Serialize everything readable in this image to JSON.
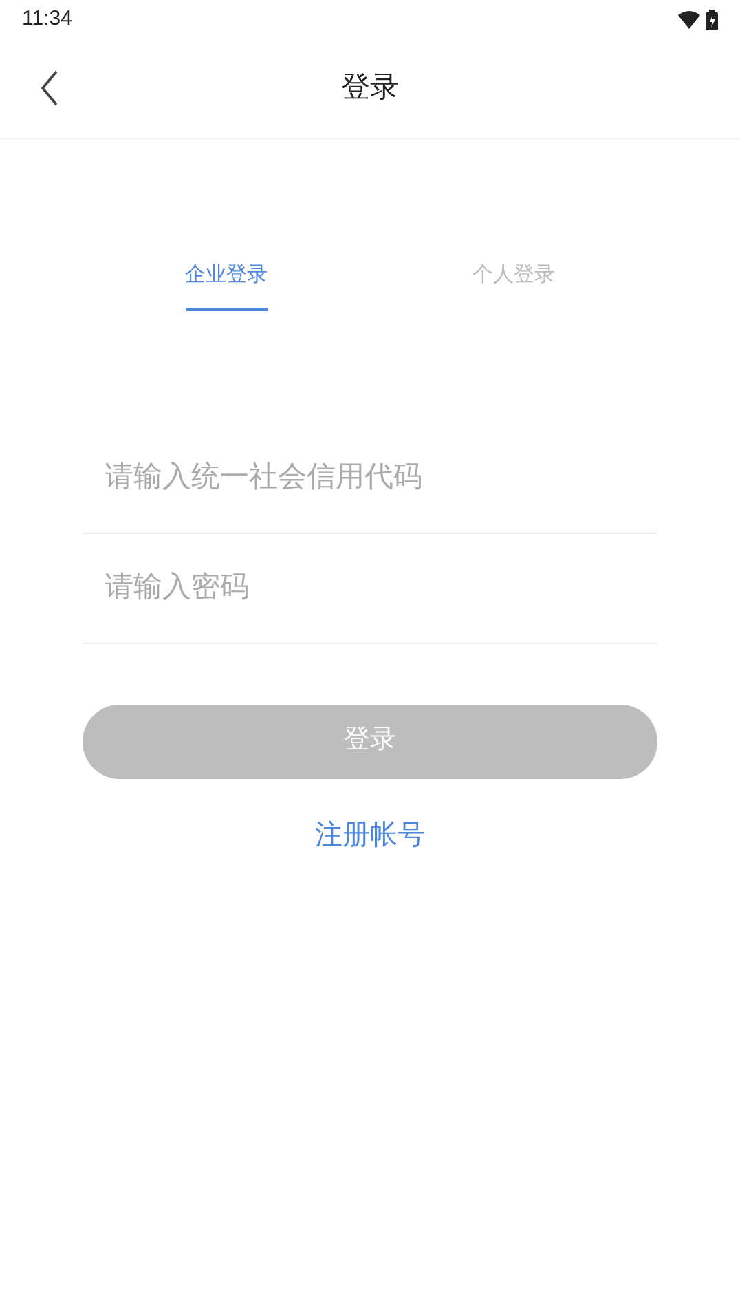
{
  "status_bar": {
    "time": "11:34"
  },
  "header": {
    "title": "登录"
  },
  "tabs": [
    {
      "label": "企业登录",
      "selected": true
    },
    {
      "label": "个人登录",
      "selected": false
    }
  ],
  "fields": [
    {
      "placeholder": "请输入统一社会信用代码"
    },
    {
      "placeholder": "请输入密码"
    }
  ],
  "login_button": {
    "label": "登录",
    "disabled": true
  },
  "register_link": "注册帐号"
}
